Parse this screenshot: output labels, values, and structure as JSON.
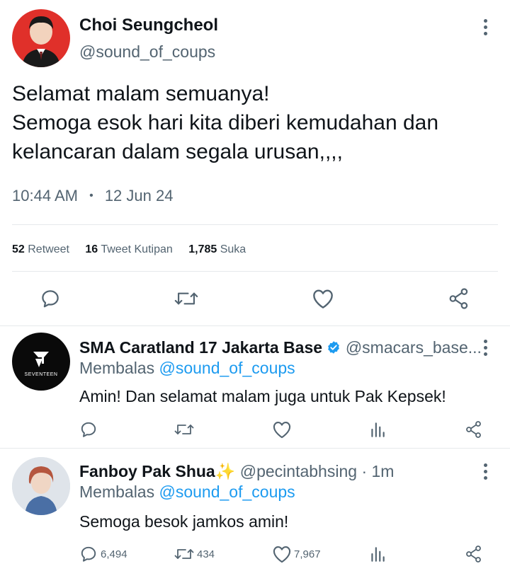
{
  "main_tweet": {
    "author_name": "Choi Seungcheol",
    "handle": "@sound_of_coups",
    "text_lines": [
      "Selamat malam semuanya!",
      "Semoga esok hari kita diberi kemudahan dan",
      "kelancaran dalam segala urusan,,,,"
    ],
    "time": "10:44 AM",
    "separator": "•",
    "date": "12 Jun 24",
    "stats": {
      "retweet_count": "52",
      "retweet_label": "Retweet",
      "quote_count": "16",
      "quote_label": "Tweet Kutipan",
      "like_count": "1,785",
      "like_label": "Suka"
    }
  },
  "replies": [
    {
      "author_name": "SMA Caratland 17 Jakarta Base",
      "verified": true,
      "handle": "@smacars_base...",
      "replying_prefix": "Membalas",
      "replying_to": "@sound_of_coups",
      "text": "Amin! Dan selamat malam juga untuk Pak Kepsek!",
      "avatar_text": "SEVENTEEN"
    },
    {
      "author_name": "Fanboy Pak Shua",
      "emoji": "✨",
      "handle": "@pecintabhsing",
      "time": "· 1m",
      "replying_prefix": "Membalas",
      "replying_to": "@sound_of_coups",
      "text": "Semoga besok jamkos amin!",
      "reply_count": "6,494",
      "retweet_count": "434",
      "like_count": "7,967"
    }
  ],
  "colors": {
    "accent": "#1d9bf0",
    "text": "#0f1419",
    "muted": "#536471",
    "verified": "#1d9bf0",
    "main_avatar_bg": "#e0302a"
  }
}
